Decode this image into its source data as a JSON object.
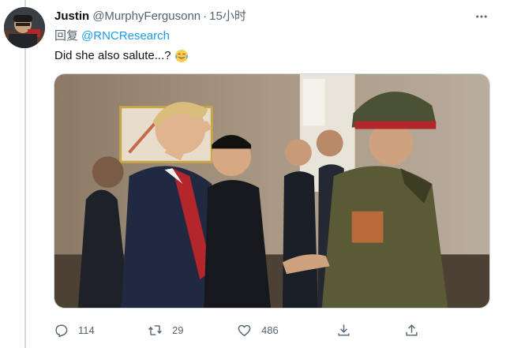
{
  "tweet": {
    "author_name": "Justin",
    "author_handle": "@MurphyFergusonn",
    "separator": "·",
    "time": "15小时",
    "reply_prefix": "回复",
    "reply_mention": "@RNCResearch",
    "text": "Did she also salute...?",
    "emoji": "face-with-tears-of-joy"
  },
  "actions": {
    "reply_count": "114",
    "retweet_count": "29",
    "like_count": "486"
  },
  "icons": [
    "more-icon",
    "reply-icon",
    "retweet-icon",
    "like-icon",
    "share-icon",
    "upload-icon"
  ],
  "colors": {
    "link": "#1d9bf0",
    "secondary_text": "#536471",
    "primary_text": "#0f1419",
    "border": "#cfd9de"
  }
}
